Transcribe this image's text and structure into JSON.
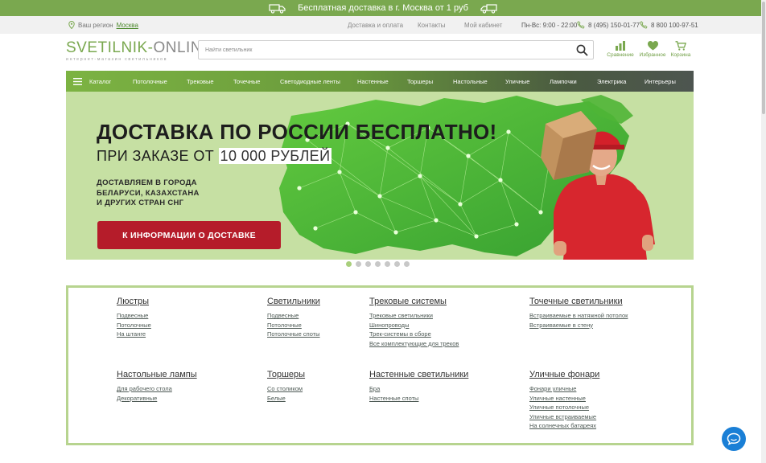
{
  "promo": {
    "text": "Бесплатная доставка в г. Москва от 1 руб"
  },
  "header": {
    "region_label": "Ваш регион",
    "region_value": "Москва",
    "links": [
      "Доставка и оплата",
      "Контакты",
      "Мой кабинет"
    ],
    "hours": "Пн-Вс: 9:00 - 22:00",
    "phone1": "8 (495) 150-01-77",
    "phone2": "8 800 100-97-51"
  },
  "logo": {
    "part1": "SVETILNIK-",
    "part2": "ONLINE",
    "tagline": "интернет-магазин светильников"
  },
  "search": {
    "placeholder": "Найти светильник"
  },
  "actions": {
    "compare": "Сравнение",
    "favorites": "Избранное",
    "cart": "Корзина"
  },
  "nav": {
    "catalog": "Каталог",
    "items": [
      "Потолочные",
      "Трековые",
      "Точечные",
      "Светодиодные ленты",
      "Настенные",
      "Торшеры",
      "Настольные",
      "Уличные",
      "Лампочки",
      "Электрика",
      "Интерьеры"
    ]
  },
  "banner": {
    "title": "ДОСТАВКА ПО РОССИИ БЕСПЛАТНО!",
    "subtitle_prefix": "ПРИ ЗАКАЗЕ ОТ",
    "subtitle_highlight": "10 000 РУБЛЕЙ",
    "small_lines": [
      "ДОСТАВЛЯЕМ В ГОРОДА",
      "БЕЛАРУСИ, КАЗАХСТАНА",
      "И ДРУГИХ СТРАН СНГ"
    ],
    "button": "К ИНФОРМАЦИИ О ДОСТАВКЕ"
  },
  "slider": {
    "count": 7,
    "active": 0
  },
  "catalog": {
    "columns": [
      {
        "title": "Люстры",
        "links": [
          "Подвесные",
          "Потолочные",
          "На штанге"
        ]
      },
      {
        "title": "Светильники",
        "links": [
          "Подвесные",
          "Потолочные",
          "Потолочные споты"
        ]
      },
      {
        "title": "Трековые системы",
        "links": [
          "Трековые светильники",
          "Шинопроводы",
          "Трек-системы в сборе",
          "Все комплектующие для треков"
        ]
      },
      {
        "title": "Точечные светильники",
        "links": [
          "Встраиваемые в натяжной потолок",
          "Встраиваемые в стену"
        ]
      },
      {
        "title": "Настольные лампы",
        "links": [
          "Для рабочего стола",
          "Декоративные"
        ]
      },
      {
        "title": "Торшеры",
        "links": [
          "Со столиком",
          "Белые"
        ]
      },
      {
        "title": "Настенные светильники",
        "links": [
          "Бра",
          "Настенные споты"
        ]
      },
      {
        "title": "Уличные фонари",
        "links": [
          "Фонари уличные",
          "Уличные настенные",
          "Уличные потолочные",
          "Уличные встраиваемые",
          "На солнечных батареях"
        ]
      }
    ]
  },
  "colors": {
    "green": "#7aa84f",
    "red": "#b51c2a",
    "chat": "#1a7fd6"
  }
}
